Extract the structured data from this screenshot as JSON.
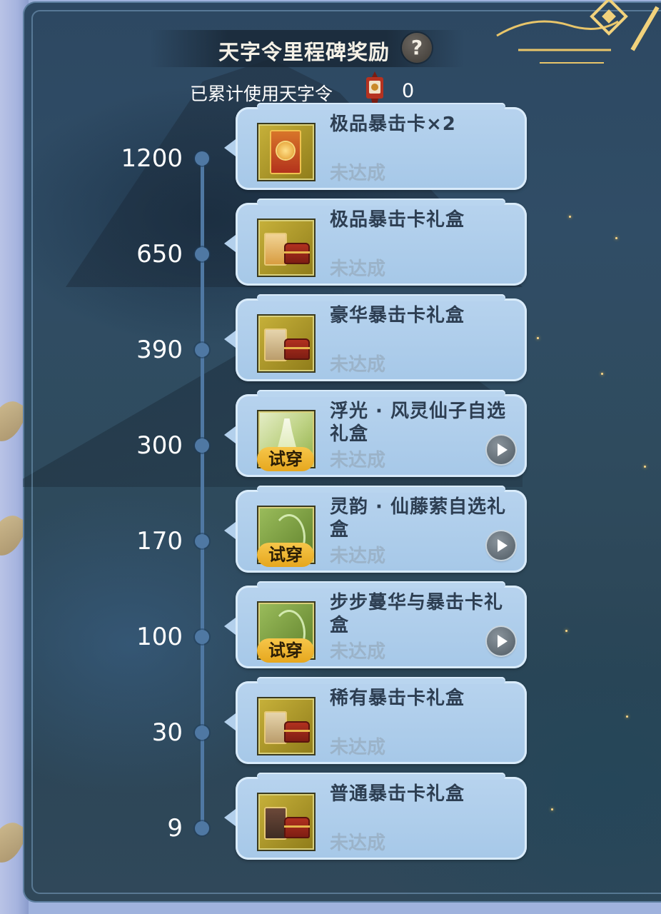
{
  "header": {
    "title": "天字令里程碑奖励",
    "help_symbol": "?",
    "usage_label": "已累计使用天字令",
    "usage_icon": "lantern-icon",
    "usage_value": "0"
  },
  "milestones": [
    {
      "threshold": "1200",
      "reward": "极品暴击卡×2",
      "status": "未达成",
      "thumb": "card-art",
      "try_on": false
    },
    {
      "threshold": "650",
      "reward": "极品暴击卡礼盒",
      "status": "未达成",
      "thumb": "fancy-card-chest",
      "try_on": false
    },
    {
      "threshold": "390",
      "reward": "豪华暴击卡礼盒",
      "status": "未达成",
      "thumb": "card-chest",
      "try_on": false
    },
    {
      "threshold": "300",
      "reward": "浮光 · 风灵仙子自选礼盒",
      "status": "未达成",
      "thumb": "costume",
      "try_on": true,
      "try_label": "试穿"
    },
    {
      "threshold": "170",
      "reward": "灵韵 · 仙藤萦自选礼盒",
      "status": "未达成",
      "thumb": "vine",
      "try_on": true,
      "try_label": "试穿"
    },
    {
      "threshold": "100",
      "reward": "步步蔓华与暴击卡礼盒",
      "status": "未达成",
      "thumb": "vine",
      "try_on": true,
      "try_label": "试穿"
    },
    {
      "threshold": "30",
      "reward": "稀有暴击卡礼盒",
      "status": "未达成",
      "thumb": "card-chest",
      "try_on": false
    },
    {
      "threshold": "9",
      "reward": "普通暴击卡礼盒",
      "status": "未达成",
      "thumb": "dark-card-chest",
      "try_on": false
    }
  ],
  "colors": {
    "panel_bg": "#2f4b5e",
    "card_bg": "#a6c8e8",
    "timeline": "#4f78a3",
    "reward_text": "#2d3e52",
    "status_text": "#9bb3c9",
    "badge": "#f6c64a"
  }
}
